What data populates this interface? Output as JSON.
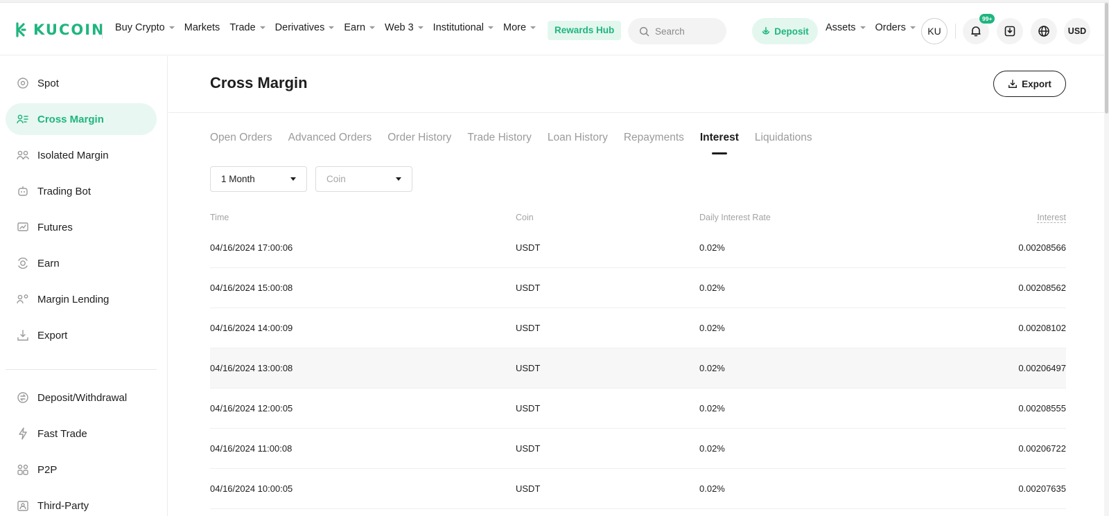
{
  "header": {
    "logo_text": "KUCOIN",
    "nav": [
      {
        "label": "Buy Crypto",
        "caret": true
      },
      {
        "label": "Markets",
        "caret": false
      },
      {
        "label": "Trade",
        "caret": true
      },
      {
        "label": "Derivatives",
        "caret": true
      },
      {
        "label": "Earn",
        "caret": true
      },
      {
        "label": "Web 3",
        "caret": true
      },
      {
        "label": "Institutional",
        "caret": true
      },
      {
        "label": "More",
        "caret": true
      }
    ],
    "rewards_label": "Rewards Hub",
    "search_placeholder": "Search",
    "deposit_label": "Deposit",
    "assets_label": "Assets",
    "orders_label": "Orders",
    "account_label": "KU",
    "notification_badge": "99+",
    "currency_label": "USD"
  },
  "sidebar": {
    "items": [
      {
        "label": "Spot",
        "icon": "spot-icon"
      },
      {
        "label": "Cross Margin",
        "icon": "cross-margin-icon",
        "active": true
      },
      {
        "label": "Isolated Margin",
        "icon": "isolated-margin-icon"
      },
      {
        "label": "Trading Bot",
        "icon": "trading-bot-icon"
      },
      {
        "label": "Futures",
        "icon": "futures-icon"
      },
      {
        "label": "Earn",
        "icon": "earn-icon"
      },
      {
        "label": "Margin Lending",
        "icon": "margin-lending-icon"
      },
      {
        "label": "Export",
        "icon": "export-icon"
      }
    ],
    "items2": [
      {
        "label": "Deposit/Withdrawal",
        "icon": "deposit-withdrawal-icon"
      },
      {
        "label": "Fast Trade",
        "icon": "fast-trade-icon"
      },
      {
        "label": "P2P",
        "icon": "p2p-icon"
      },
      {
        "label": "Third-Party",
        "icon": "third-party-icon"
      }
    ]
  },
  "main": {
    "title": "Cross Margin",
    "export_label": "Export",
    "tabs": [
      {
        "label": "Open Orders"
      },
      {
        "label": "Advanced Orders"
      },
      {
        "label": "Order History"
      },
      {
        "label": "Trade History"
      },
      {
        "label": "Loan History"
      },
      {
        "label": "Repayments"
      },
      {
        "label": "Interest",
        "active": true
      },
      {
        "label": "Liquidations"
      }
    ],
    "filters": {
      "period": "1 Month",
      "coin_placeholder": "Coin"
    },
    "table": {
      "columns": [
        "Time",
        "Coin",
        "Daily Interest Rate",
        "Interest"
      ],
      "rows": [
        [
          "04/16/2024 17:00:06",
          "USDT",
          "0.02%",
          "0.00208566"
        ],
        [
          "04/16/2024 15:00:08",
          "USDT",
          "0.02%",
          "0.00208562"
        ],
        [
          "04/16/2024 14:00:09",
          "USDT",
          "0.02%",
          "0.00208102"
        ],
        [
          "04/16/2024 13:00:08",
          "USDT",
          "0.02%",
          "0.00206497"
        ],
        [
          "04/16/2024 12:00:05",
          "USDT",
          "0.02%",
          "0.00208555"
        ],
        [
          "04/16/2024 11:00:08",
          "USDT",
          "0.02%",
          "0.00206722"
        ],
        [
          "04/16/2024 10:00:05",
          "USDT",
          "0.02%",
          "0.00207635"
        ]
      ]
    }
  },
  "colors": {
    "accent": "#1fb57f",
    "accent_bg": "#e3f7ee",
    "text": "#1d1d1d",
    "muted": "#9b9b9b"
  }
}
